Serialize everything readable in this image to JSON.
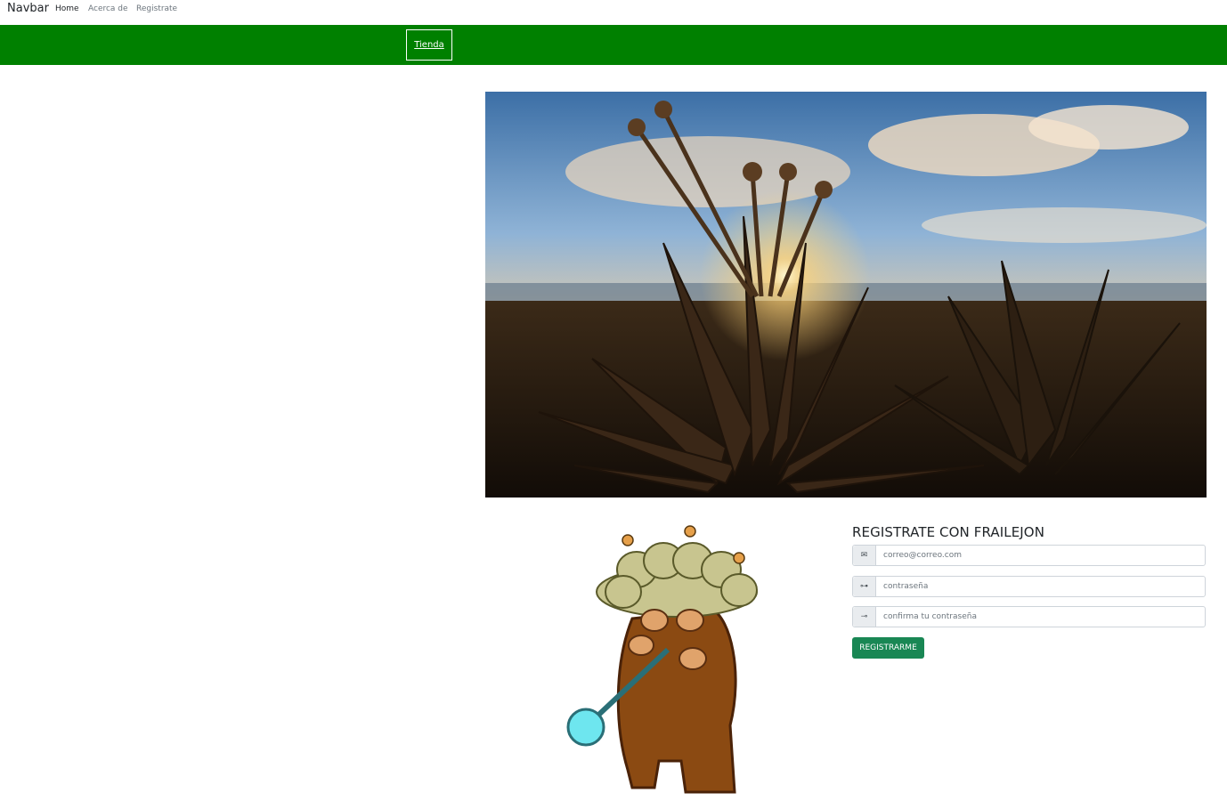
{
  "navbar": {
    "brand": "Navbar",
    "links": [
      {
        "label": "Home",
        "active": true
      },
      {
        "label": "Acerca de",
        "active": false
      },
      {
        "label": "Registrate",
        "active": false
      }
    ]
  },
  "banner": {
    "color": "#008000",
    "shop_button": "Tienda"
  },
  "hero": {
    "image": "frailejon-sunset-photo"
  },
  "mascot": {
    "image": "frailejon-mascot-illustration"
  },
  "form": {
    "title": "REGISTRATE CON FRAILEJON",
    "fields": [
      {
        "icon": "email-icon",
        "placeholder": "correo@correo.com"
      },
      {
        "icon": "key-outline-icon",
        "placeholder": "contraseña"
      },
      {
        "icon": "key-solid-icon",
        "placeholder": "confirma tu contraseña"
      }
    ],
    "submit_label": "REGISTRARME",
    "submit_color": "#198754"
  }
}
